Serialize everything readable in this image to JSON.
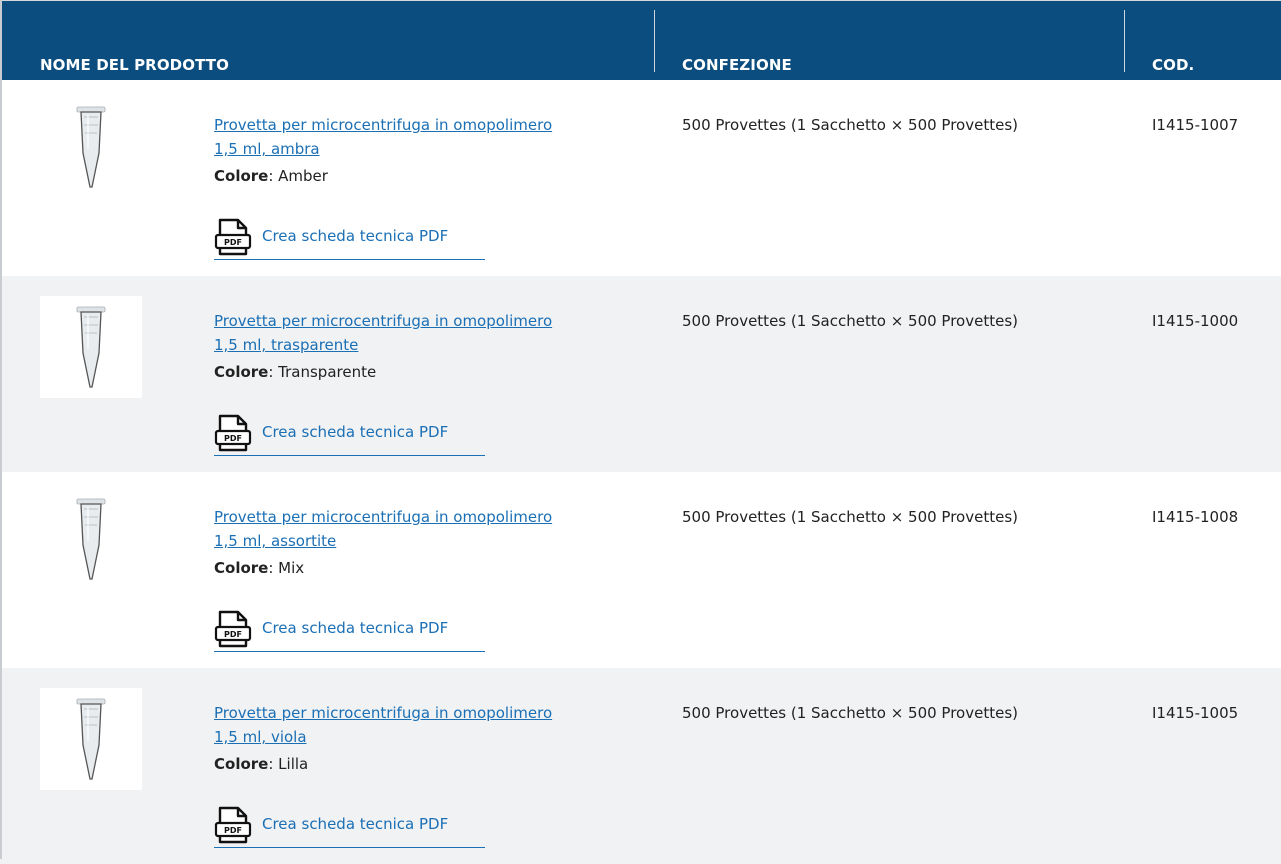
{
  "table": {
    "headers": {
      "product_name": "NOME DEL PRODOTTO",
      "package": "CONFEZIONE",
      "code": "COD."
    },
    "rows": [
      {
        "name_line1": "Provetta per microcentrifuga in omopolimero",
        "name_line2": "1,5 ml, ambra",
        "color_label": "Colore",
        "color_value": ": Amber",
        "pdf_label": "Crea scheda tecnica PDF",
        "package": "500 Provettes (1 Sacchetto × 500 Provettes)",
        "code": "I1415-1007"
      },
      {
        "name_line1": "Provetta per microcentrifuga in omopolimero",
        "name_line2": "1,5 ml, trasparente",
        "color_label": "Colore",
        "color_value": ": Transparente",
        "pdf_label": "Crea scheda tecnica PDF",
        "package": "500 Provettes (1 Sacchetto × 500 Provettes)",
        "code": "I1415-1000"
      },
      {
        "name_line1": "Provetta per microcentrifuga in omopolimero",
        "name_line2": "1,5 ml, assortite",
        "color_label": "Colore",
        "color_value": ": Mix",
        "pdf_label": "Crea scheda tecnica PDF",
        "package": "500 Provettes (1 Sacchetto × 500 Provettes)",
        "code": "I1415-1008"
      },
      {
        "name_line1": "Provetta per microcentrifuga in omopolimero",
        "name_line2": "1,5 ml, viola",
        "color_label": "Colore",
        "color_value": ": Lilla",
        "pdf_label": "Crea scheda tecnica PDF",
        "package": "500 Provettes (1 Sacchetto × 500 Provettes)",
        "code": "I1415-1005"
      }
    ]
  },
  "icons": {
    "product_image": "microcentrifuge-tube-icon",
    "pdf": "pdf-document-icon"
  },
  "colors": {
    "header_bg": "#0a4d7e",
    "link": "#1a6fb5",
    "alt_row_bg": "#f1f2f4"
  }
}
